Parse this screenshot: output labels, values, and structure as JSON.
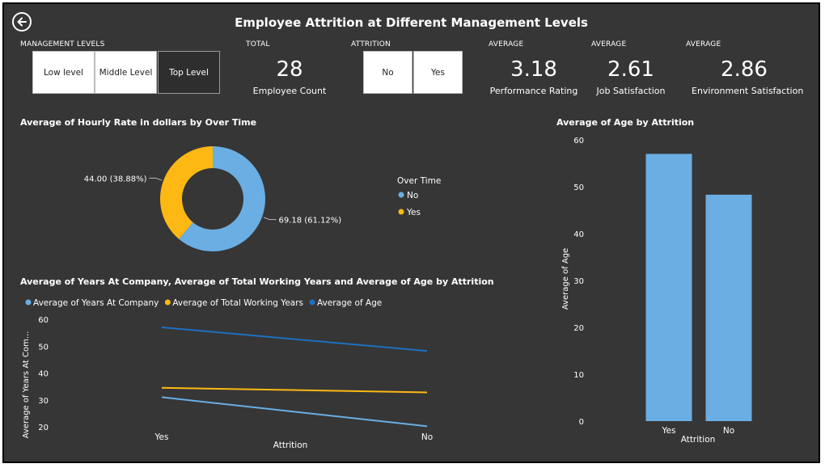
{
  "title": "Employee Attrition at Different Management Levels",
  "back_icon": "arrow-left-circle-icon",
  "management_levels": {
    "caption": "MANAGEMENT LEVELS",
    "options": [
      {
        "label": "Low level",
        "selected": false
      },
      {
        "label": "Middle Level",
        "selected": false
      },
      {
        "label": "Top Level",
        "selected": true
      }
    ]
  },
  "total": {
    "caption": "TOTAL",
    "value": "28",
    "label": "Employee Count"
  },
  "attrition_slicer": {
    "caption": "ATTRITION",
    "options": [
      {
        "label": "No",
        "selected": false
      },
      {
        "label": "Yes",
        "selected": false
      }
    ]
  },
  "kpis": [
    {
      "caption": "AVERAGE",
      "value": "3.18",
      "label": "Performance Rating"
    },
    {
      "caption": "AVERAGE",
      "value": "2.61",
      "label": "Job Satisfaction"
    },
    {
      "caption": "AVERAGE",
      "value": "2.86",
      "label": "Environment Satisfaction"
    }
  ],
  "colors": {
    "background": "#363636",
    "light_blue": "#6AAEE3",
    "yellow": "#FDB813",
    "dark_blue": "#1C70C2"
  },
  "chart_data": [
    {
      "type": "pie",
      "title": "Average of Hourly Rate in dollars by Over Time",
      "legend_title": "Over Time",
      "legend_position": "right",
      "slices": [
        {
          "name": "No",
          "value": 69.18,
          "label": "69.18 (61.12%)",
          "color": "#6AAEE3"
        },
        {
          "name": "Yes",
          "value": 44.0,
          "label": "44.00 (38.88%)",
          "color": "#FDB813"
        }
      ]
    },
    {
      "type": "line",
      "title": "Average of Years At Company, Average of Total Working Years and Average of Age by Attrition",
      "legend_position": "top-left",
      "categories": [
        "Yes",
        "No"
      ],
      "xlabel": "Attrition",
      "ylabel": "Average of Years At Com...",
      "ylim": [
        20,
        60
      ],
      "yticks": [
        "60",
        "50",
        "40",
        "30",
        "20"
      ],
      "series": [
        {
          "name": "Average of Years At Company",
          "values": [
            31,
            20.2
          ],
          "color": "#6AAEE3"
        },
        {
          "name": "Average of Total Working Years",
          "values": [
            34.5,
            32.8
          ],
          "color": "#FDB813"
        },
        {
          "name": "Average of Age",
          "values": [
            57,
            48.2
          ],
          "color": "#1C70C2"
        }
      ]
    },
    {
      "type": "bar",
      "title": "Average of Age by Attrition",
      "categories": [
        "Yes",
        "No"
      ],
      "values": [
        57,
        48.3
      ],
      "xlabel": "Attrition",
      "ylabel": "Average of Age",
      "ylim": [
        0,
        60
      ],
      "yticks": [
        "0",
        "10",
        "20",
        "30",
        "40",
        "50",
        "60"
      ],
      "color": "#6AAEE3"
    }
  ]
}
